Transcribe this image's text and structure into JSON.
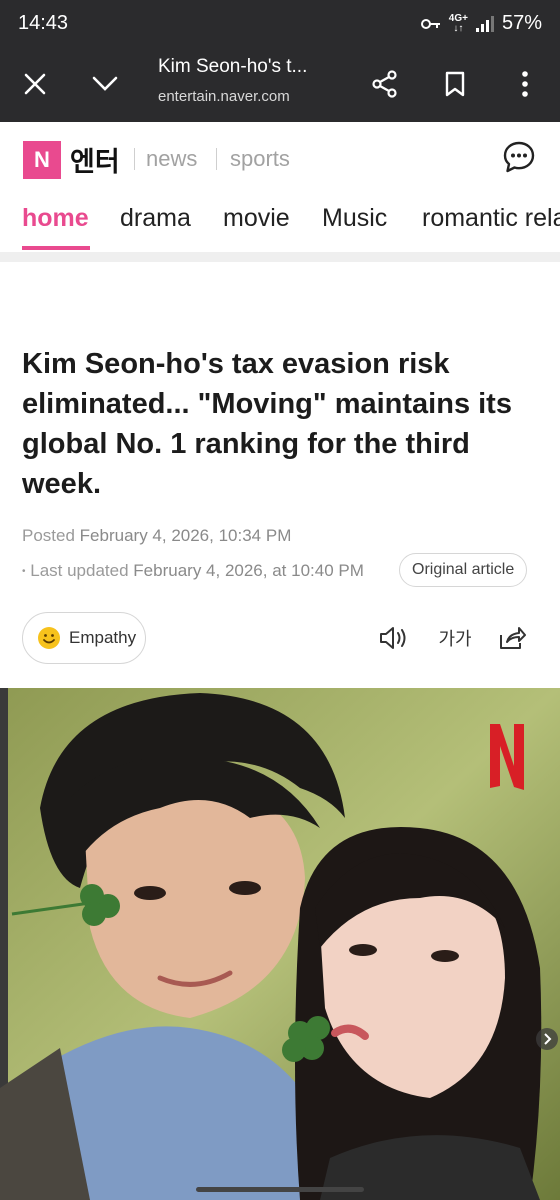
{
  "status_bar": {
    "time": "14:43",
    "network": "4G+",
    "battery": "57%"
  },
  "browser": {
    "tab_title": "Kim Seon-ho's t...",
    "url": "entertain.naver.com"
  },
  "site": {
    "logo_letter": "N",
    "logo_text": "엔터",
    "links": [
      "news",
      "sports"
    ]
  },
  "tabs": [
    {
      "label": "home",
      "active": true
    },
    {
      "label": "drama"
    },
    {
      "label": "movie"
    },
    {
      "label": "Music"
    },
    {
      "label": "romantic rela"
    }
  ],
  "article": {
    "headline": "Kim Seon-ho's tax evasion risk eliminated... \"Moving\" maintains its global No. 1 ranking for the third week.",
    "posted_label": "Posted",
    "posted_value": "February 4, 2026, 10:34 PM",
    "updated_label": "Last updated",
    "updated_value": "February 4, 2026, at 10:40 PM",
    "original_article": "Original article",
    "empathy": "Empathy",
    "font_size_label": "가가"
  },
  "colors": {
    "brand_pink": "#e94a8f",
    "browser_bar": "#2b2b2d",
    "netflix_red": "#d81f26"
  },
  "icons": [
    "close-icon",
    "chevron-down-icon",
    "share-icon",
    "bookmark-icon",
    "more-vert-icon",
    "chat-icon",
    "speaker-icon",
    "share-out-icon",
    "chevron-right-icon"
  ]
}
